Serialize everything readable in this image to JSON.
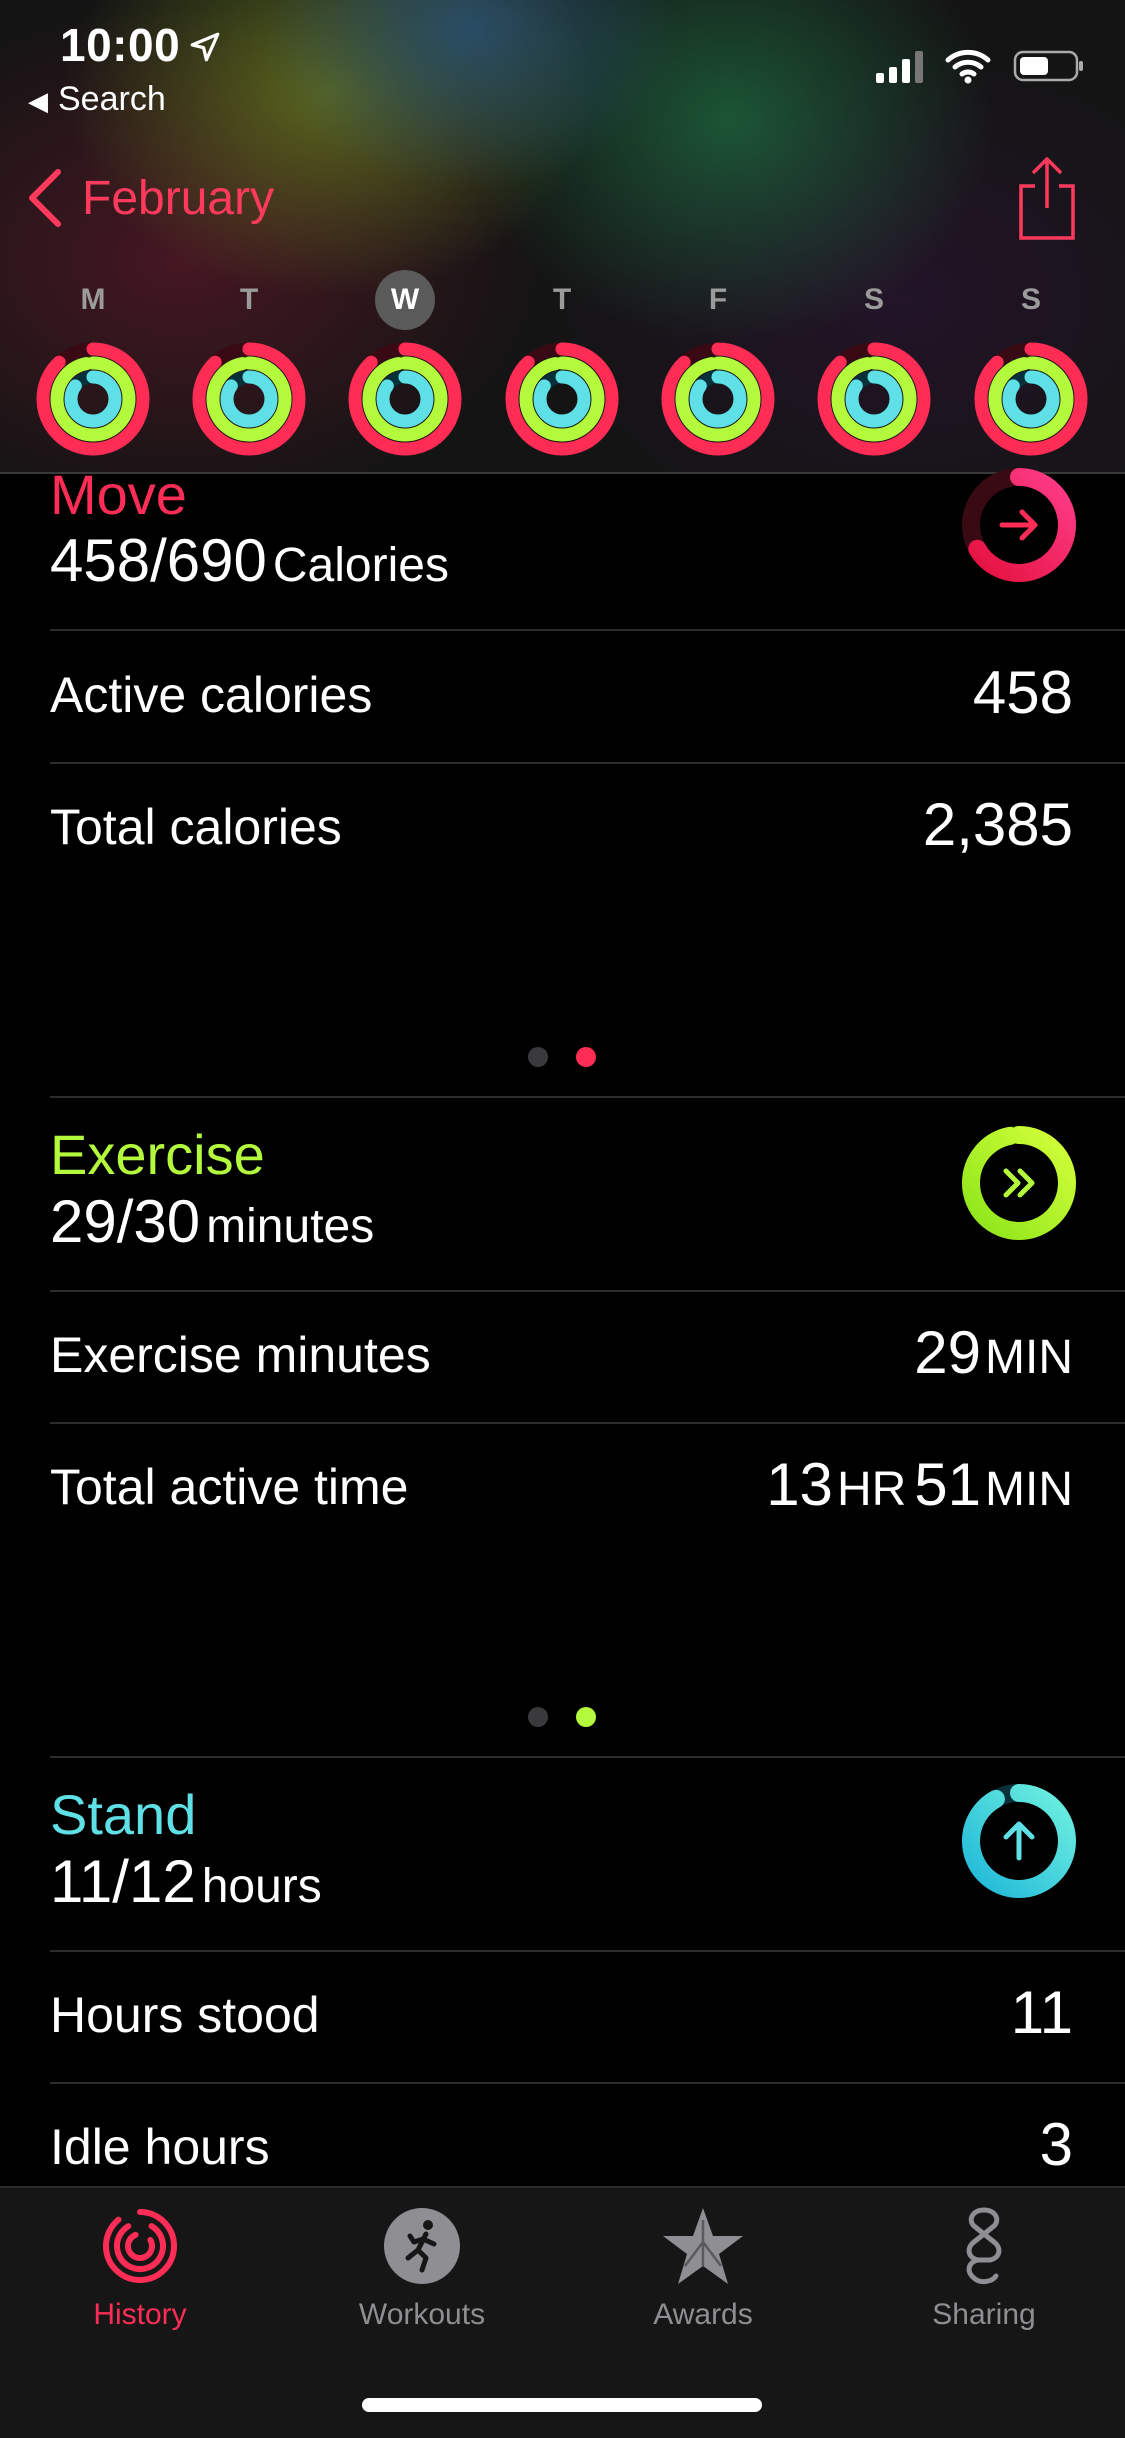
{
  "status_bar": {
    "time": "10:00",
    "back_app": "Search"
  },
  "nav": {
    "back_label": "February",
    "share_icon": "share-icon"
  },
  "week": {
    "days": [
      {
        "letter": "M",
        "current": false
      },
      {
        "letter": "T",
        "current": false
      },
      {
        "letter": "W",
        "current": true
      },
      {
        "letter": "T",
        "current": false
      },
      {
        "letter": "F",
        "current": false
      },
      {
        "letter": "S",
        "current": false
      },
      {
        "letter": "S",
        "current": false
      }
    ]
  },
  "move": {
    "title": "Move",
    "value": "458/690",
    "unit": "Calories",
    "rows": [
      {
        "label": "Active calories",
        "value": "458"
      },
      {
        "label": "Total calories",
        "value": "2,385"
      }
    ],
    "page_indicator": {
      "count": 2,
      "active": 1
    }
  },
  "exercise": {
    "title": "Exercise",
    "value": "29/30",
    "unit": "minutes",
    "rows": [
      {
        "label": "Exercise minutes",
        "value": "29",
        "unit": "MIN"
      },
      {
        "label": "Total active time",
        "hours": "13",
        "hours_unit": "HR",
        "minutes": "51",
        "minutes_unit": "MIN"
      }
    ],
    "page_indicator": {
      "count": 2,
      "active": 1
    }
  },
  "stand": {
    "title": "Stand",
    "value": "11/12",
    "unit": "hours",
    "rows": [
      {
        "label": "Hours stood",
        "value": "11"
      },
      {
        "label": "Idle hours",
        "value": "3"
      }
    ]
  },
  "tabs": [
    {
      "label": "History",
      "icon": "history-rings-icon",
      "active": true
    },
    {
      "label": "Workouts",
      "icon": "running-figure-icon",
      "active": false
    },
    {
      "label": "Awards",
      "icon": "star-award-icon",
      "active": false
    },
    {
      "label": "Sharing",
      "icon": "sharing-icon",
      "active": false
    }
  ],
  "colors": {
    "move": "#ff2d55",
    "exercise": "#b4fa3c",
    "stand": "#5ee0e6",
    "accent": "#ff3a5c",
    "background": "#000000"
  }
}
